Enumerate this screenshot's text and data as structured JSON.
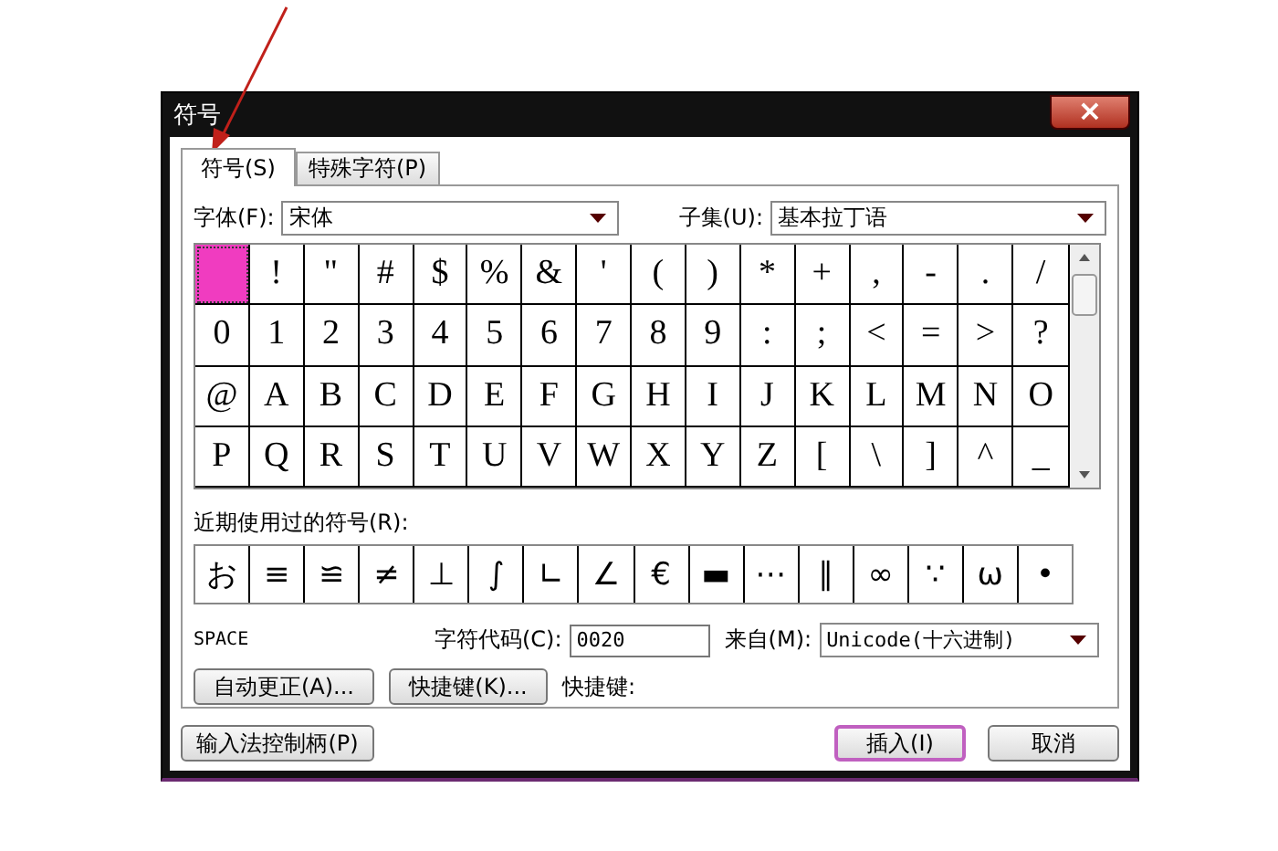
{
  "window": {
    "title": "符号",
    "close": "×"
  },
  "tabs": [
    {
      "label": "符号(S)",
      "selected": true
    },
    {
      "label": "特殊字符(P)",
      "selected": false
    }
  ],
  "font": {
    "label": "字体(F):",
    "value": "宋体"
  },
  "subset": {
    "label": "子集(U):",
    "value": "基本拉丁语"
  },
  "grid": [
    {
      "selected": true
    },
    {
      "char": "!",
      "selected": false
    },
    {
      "char": "\"",
      "selected": false
    },
    {
      "char": "#",
      "selected": false
    },
    {
      "char": "$",
      "selected": false
    },
    {
      "char": "%",
      "selected": false
    },
    {
      "char": "&",
      "selected": false
    },
    {
      "char": "'",
      "selected": false
    },
    {
      "char": "(",
      "selected": false
    },
    {
      "char": ")",
      "selected": false
    },
    {
      "char": "*",
      "selected": false
    },
    {
      "char": "+",
      "selected": false
    },
    {
      "char": ",",
      "selected": false
    },
    {
      "char": "-",
      "selected": false
    },
    {
      "char": ".",
      "selected": false
    },
    {
      "char": "/",
      "selected": false
    },
    {
      "char": "0",
      "selected": false
    },
    {
      "char": "1",
      "selected": false
    },
    {
      "char": "2",
      "selected": false
    },
    {
      "char": "3",
      "selected": false
    },
    {
      "char": "4",
      "selected": false
    },
    {
      "char": "5",
      "selected": false
    },
    {
      "char": "6",
      "selected": false
    },
    {
      "char": "7",
      "selected": false
    },
    {
      "char": "8",
      "selected": false
    },
    {
      "char": "9",
      "selected": false
    },
    {
      "char": ":",
      "selected": false
    },
    {
      "char": ";",
      "selected": false
    },
    {
      "char": "<",
      "selected": false
    },
    {
      "char": "=",
      "selected": false
    },
    {
      "char": ">",
      "selected": false
    },
    {
      "char": "?",
      "selected": false
    },
    {
      "char": "@",
      "selected": false
    },
    {
      "char": "A",
      "selected": false
    },
    {
      "char": "B",
      "selected": false
    },
    {
      "char": "C",
      "selected": false
    },
    {
      "char": "D",
      "selected": false
    },
    {
      "char": "E",
      "selected": false
    },
    {
      "char": "F",
      "selected": false
    },
    {
      "char": "G",
      "selected": false
    },
    {
      "char": "H",
      "selected": false
    },
    {
      "char": "I",
      "selected": false
    },
    {
      "char": "J",
      "selected": false
    },
    {
      "char": "K",
      "selected": false
    },
    {
      "char": "L",
      "selected": false
    },
    {
      "char": "M",
      "selected": false
    },
    {
      "char": "N",
      "selected": false
    },
    {
      "char": "O",
      "selected": false
    },
    {
      "char": "P",
      "selected": false
    },
    {
      "char": "Q",
      "selected": false
    },
    {
      "char": "R",
      "selected": false
    },
    {
      "char": "S",
      "selected": false
    },
    {
      "char": "T",
      "selected": false
    },
    {
      "char": "U",
      "selected": false
    },
    {
      "char": "V",
      "selected": false
    },
    {
      "char": "W",
      "selected": false
    },
    {
      "char": "X",
      "selected": false
    },
    {
      "char": "Y",
      "selected": false
    },
    {
      "char": "Z",
      "selected": false
    },
    {
      "char": "[",
      "selected": false
    },
    {
      "char": "\\",
      "selected": false
    },
    {
      "char": "]",
      "selected": false
    },
    {
      "char": "^",
      "selected": false
    },
    {
      "char": "_",
      "selected": false
    }
  ],
  "recent": {
    "label": "近期使用过的符号(R):",
    "symbols": [
      "お",
      "≡",
      "≌",
      "≠",
      "⊥",
      "∫",
      "∟",
      "∠",
      "€",
      "▬",
      "⋯",
      "∥",
      "∞",
      "∵",
      "ω",
      "•"
    ]
  },
  "char_name": "SPACE",
  "code": {
    "label": "字符代码(C):",
    "value": "0020"
  },
  "from": {
    "label": "来自(M):",
    "value": "Unicode(十六进制)"
  },
  "autocorrect_button": "自动更正(A)...",
  "shortcut_button": "快捷键(K)...",
  "shortcut_label": "快捷键:",
  "ime_button": "输入法控制柄(P)",
  "insert_button": "插入(I)",
  "cancel_button": "取消"
}
